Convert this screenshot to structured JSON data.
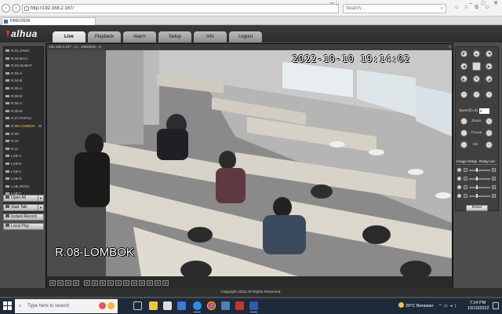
{
  "browser": {
    "url": "http://192.168.2.167/",
    "search_placeholder": "Search...",
    "tab_title": "PREVIEW",
    "back_icon": "back-arrow-icon",
    "forward_icon": "forward-arrow-icon"
  },
  "app": {
    "logo_text": "alhua",
    "menu": [
      {
        "label": "Live",
        "active": true
      },
      {
        "label": "Playback"
      },
      {
        "label": "Alarm"
      },
      {
        "label": "Setup"
      },
      {
        "label": "Info"
      },
      {
        "label": "Logout"
      }
    ],
    "cameras": [
      "R.01-JAWA",
      "R.02-BALI",
      "R.03-SUMAT",
      "R.04-A",
      "R.04-B",
      "R.05-A",
      "R.05-B",
      "R.06-A",
      "R.06-B",
      "R.07-PAPUA",
      "R.08-LOMBOK",
      "R.09",
      "R.10",
      "R.11",
      "LAB-A",
      "LAB-B",
      "LAB-C",
      "LAB-D",
      "LAB-JRGN",
      "LAB-F"
    ],
    "active_camera_index": 10,
    "active_camera_marker": "M",
    "controls": {
      "open_all": "Open All",
      "start_talk": "Start Talk",
      "instant_record": "Instant Record",
      "local_play": "Local Play"
    },
    "video": {
      "info_bar": "192.168.2.167 , 11 , 1051kbps , 8",
      "close_glyph": "×",
      "osd_timestamp": "2022-10-10 19:14:02",
      "osd_camera_name": "R.08-LOMBOK"
    },
    "ptz": {
      "speed_label": "Speed(1-8)",
      "speed_value": "5",
      "zoom_label": "Zoom",
      "focus_label": "Focus",
      "iris_label": "Iris",
      "image_setup_label": "Image Setup",
      "relay_out_label": "Relay-out",
      "reset_label": "Reset",
      "sliders": [
        {
          "name": "brightness",
          "level": 0.35
        },
        {
          "name": "contrast",
          "level": 0.35
        },
        {
          "name": "saturation",
          "level": 0.35
        },
        {
          "name": "hue",
          "level": 0.35
        }
      ]
    },
    "copyright": "Copyright 2015,All Rights Reserved."
  },
  "taskbar": {
    "search_placeholder": "Type here to search",
    "weather_temp": "29°C",
    "weather_text": "Berawan",
    "time": "7:14 PM",
    "date": "10/10/2022"
  },
  "colors": {
    "app_bg": "#4d4d4d",
    "header_bg": "#2c2c2c",
    "active_camera": "#f0c050",
    "taskbar_bg": "#1e2a3a"
  }
}
